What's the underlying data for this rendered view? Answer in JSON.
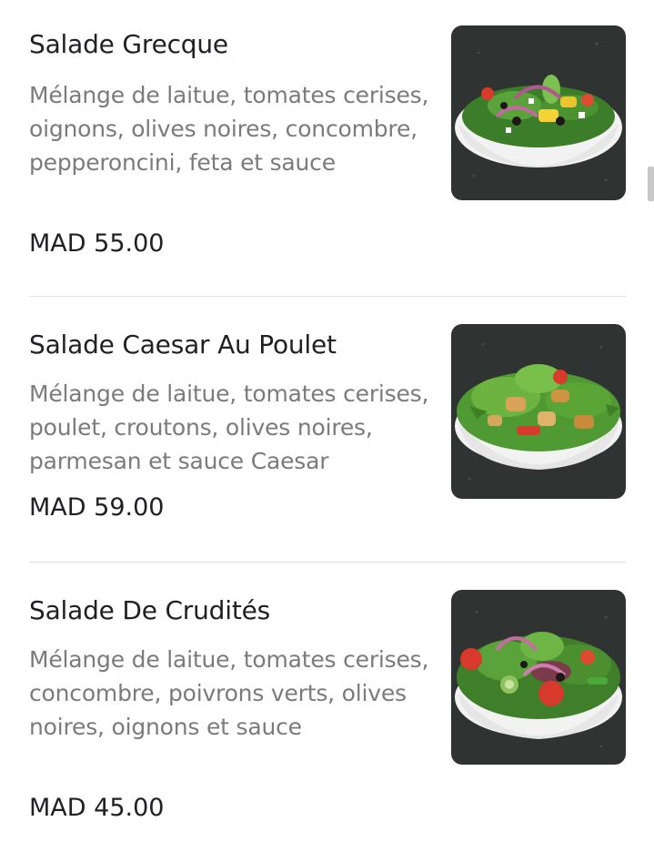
{
  "menu": {
    "items": [
      {
        "name": "Salade Grecque",
        "description": "Mélange de laitue, tomates cerises, oignons, olives noires, concombre, pepperoncini, feta et sauce",
        "price": "MAD 55.00",
        "image_icon": "greek-salad-photo"
      },
      {
        "name": "Salade Caesar Au Poulet",
        "description": "Mélange de laitue, tomates cerises, poulet, croutons, olives noires, parmesan et sauce Caesar",
        "price": "MAD 59.00",
        "image_icon": "caesar-salad-photo"
      },
      {
        "name": "Salade De Crudités",
        "description": "Mélange de laitue, tomates cerises, concombre, poivrons verts, olives noires, oignons et sauce",
        "price": "MAD 45.00",
        "image_icon": "crudites-salad-photo"
      }
    ]
  },
  "colors": {
    "title": "#202124",
    "description": "#7b7b7b",
    "divider": "#e3e3e3",
    "photo_background": "#2f3432"
  }
}
